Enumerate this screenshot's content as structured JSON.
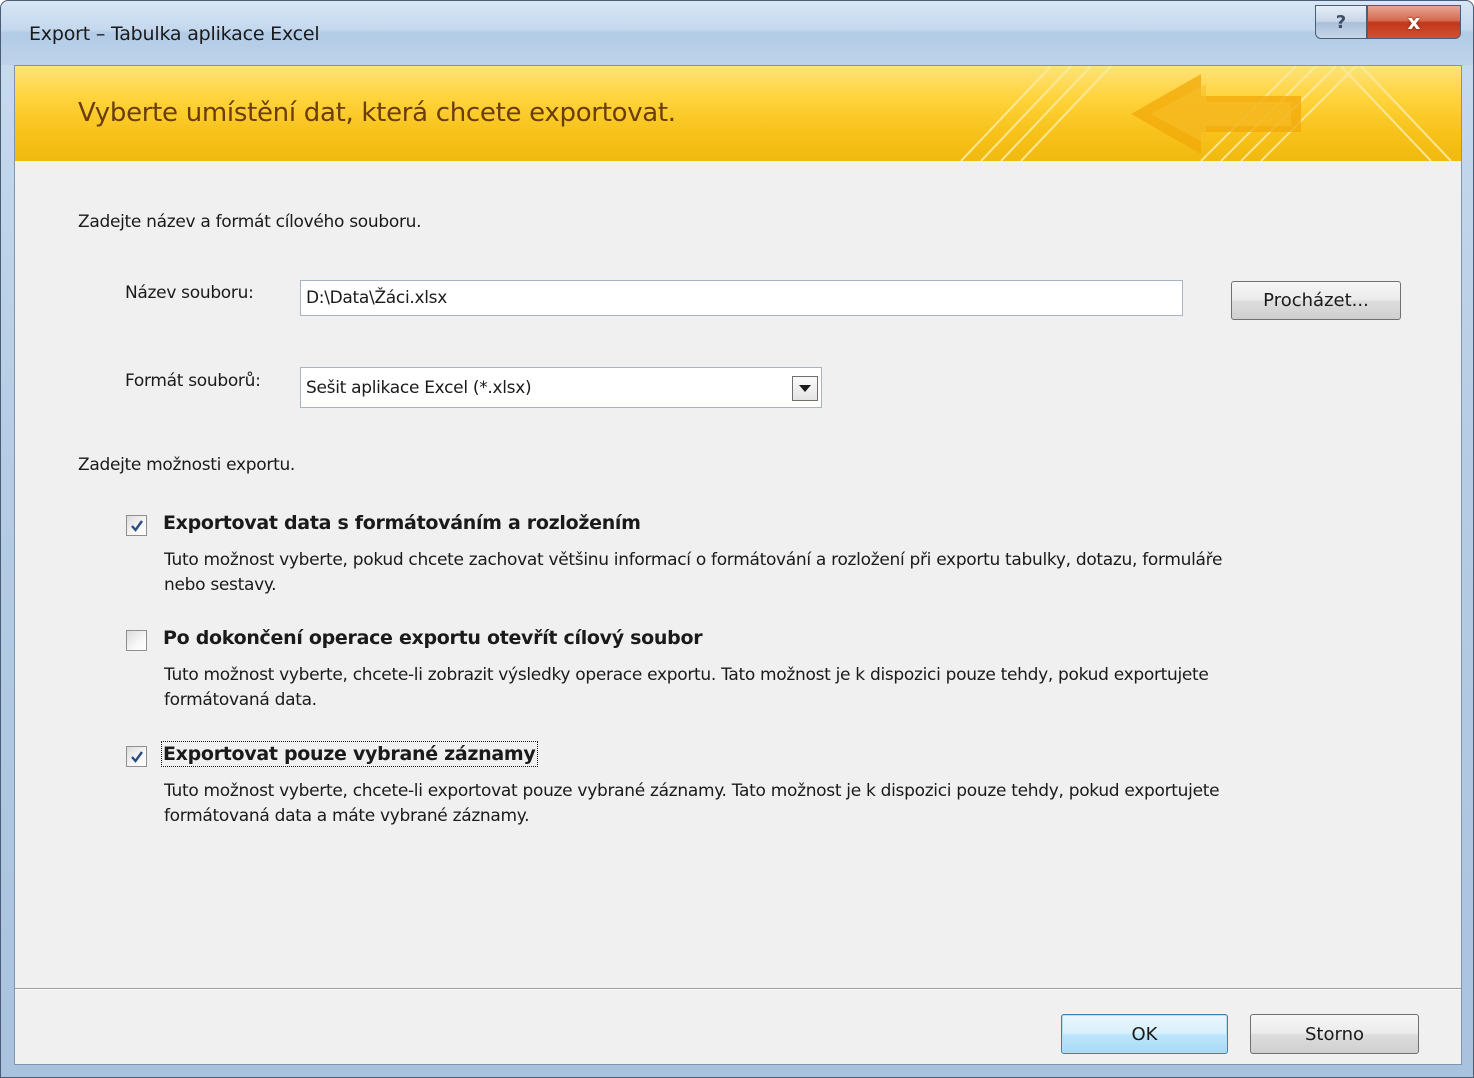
{
  "window": {
    "title": "Export – Tabulka aplikace Excel",
    "help_glyph": "?",
    "close_glyph": "x"
  },
  "banner": {
    "title": "Vyberte umístění dat, která chcete exportovat."
  },
  "section_file": {
    "heading": "Zadejte název a formát cílového souboru.",
    "filename_label": "Název souboru:",
    "filename_value": "D:\\Data\\Žáci.xlsx",
    "browse_button": "Procházet...",
    "format_label": "Formát souborů:",
    "format_value": "Sešit aplikace Excel (*.xlsx)"
  },
  "section_options": {
    "heading": "Zadejte možnosti exportu.",
    "options": [
      {
        "label": "Exportovat data s formátováním a rozložením",
        "checked": true,
        "description_line1": "Tuto možnost vyberte, pokud chcete zachovat většinu informací o formátování a rozložení při exportu tabulky, dotazu, formuláře",
        "description_line2": "nebo sestavy."
      },
      {
        "label": "Po dokončení operace exportu otevřít cílový soubor",
        "checked": false,
        "description_line1": "Tuto možnost vyberte, chcete-li zobrazit výsledky operace exportu. Tato možnost je k dispozici pouze tehdy, pokud exportujete",
        "description_line2": "formátovaná data."
      },
      {
        "label": "Exportovat pouze vybrané záznamy",
        "checked": true,
        "description_line1": "Tuto možnost vyberte, chcete-li exportovat pouze vybrané záznamy. Tato možnost je k dispozici pouze tehdy, pokud exportujete",
        "description_line2": "formátovaná data a máte vybrané záznamy."
      }
    ]
  },
  "footer": {
    "ok_button": "OK",
    "cancel_button": "Storno"
  }
}
